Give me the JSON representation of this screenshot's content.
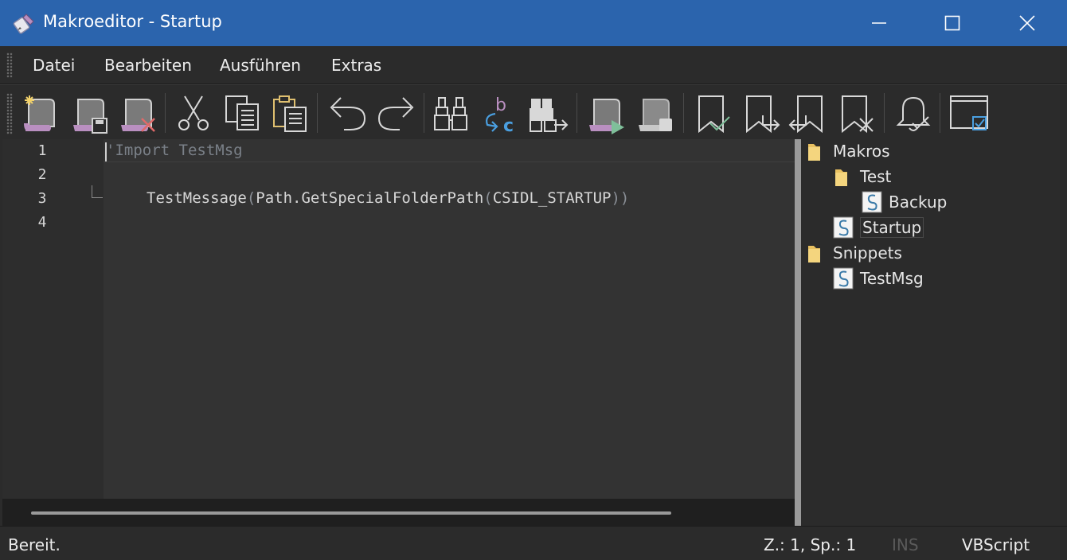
{
  "window": {
    "title": "Makroeditor - Startup",
    "app_icon": "scroll-pen-icon"
  },
  "menu": {
    "items": [
      "Datei",
      "Bearbeiten",
      "Ausführen",
      "Extras"
    ]
  },
  "toolbar": {
    "buttons": [
      "new-macro-icon",
      "save-macro-icon",
      "delete-macro-icon",
      "cut-icon",
      "copy-icon",
      "paste-icon",
      "undo-icon",
      "redo-icon",
      "find-icon",
      "replace-icon",
      "find-next-icon",
      "run-macro-icon",
      "stop-macro-icon",
      "bookmark-toggle-icon",
      "bookmark-next-icon",
      "bookmark-previous-icon",
      "bookmark-clear-icon",
      "notification-icon",
      "options-icon"
    ]
  },
  "editor": {
    "lines": [
      {
        "num": "1",
        "comment": "'Import TestMsg"
      },
      {
        "num": "2"
      },
      {
        "num": "3",
        "func": "TestMessage",
        "open1": "(",
        "arg_obj": "Path.GetSpecialFolderPath",
        "open2": "(",
        "const": "CSIDL_STARTUP",
        "close": "))"
      },
      {
        "num": "4"
      }
    ]
  },
  "tree": {
    "nodes": [
      {
        "label": "Makros",
        "type": "folder"
      },
      {
        "label": "Test",
        "type": "folder"
      },
      {
        "label": "Backup",
        "type": "script"
      },
      {
        "label": "Startup",
        "type": "script",
        "selected": true
      },
      {
        "label": "Snippets",
        "type": "folder"
      },
      {
        "label": "TestMsg",
        "type": "script"
      }
    ]
  },
  "status": {
    "ready": "Bereit.",
    "position": "Z.: 1, Sp.: 1",
    "ins": "INS",
    "language": "VBScript"
  },
  "colors": {
    "titlebar": "#2b64ad",
    "accent_purple": "#b98fc0",
    "check_green": "#7fbf9a",
    "info_blue": "#4a9fe0"
  }
}
